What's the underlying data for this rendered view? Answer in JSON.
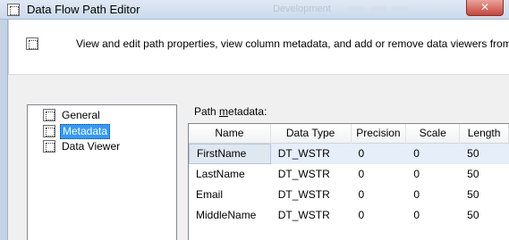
{
  "window": {
    "title": "Data Flow Path Editor",
    "background_title": "Development",
    "close_label": "✕"
  },
  "banner": {
    "description": "View and edit path properties, view column metadata, and add or remove data viewers from"
  },
  "tree": {
    "items": [
      {
        "label": "General",
        "selected": false
      },
      {
        "label": "Metadata",
        "selected": true
      },
      {
        "label": "Data Viewer",
        "selected": false
      }
    ]
  },
  "metadata": {
    "label_prefix": "Path ",
    "label_mnemonic": "m",
    "label_suffix": "etadata:",
    "columns": [
      "Name",
      "Data Type",
      "Precision",
      "Scale",
      "Length"
    ],
    "rows": [
      [
        "FirstName",
        "DT_WSTR",
        "0",
        "0",
        "50"
      ],
      [
        "LastName",
        "DT_WSTR",
        "0",
        "0",
        "50"
      ],
      [
        "Email",
        "DT_WSTR",
        "0",
        "0",
        "50"
      ],
      [
        "MiddleName",
        "DT_WSTR",
        "0",
        "0",
        "50"
      ]
    ]
  },
  "colors": {
    "selection": "#3399ff",
    "close_button": "#c9453a",
    "title_bar": "#cbdaeb"
  }
}
